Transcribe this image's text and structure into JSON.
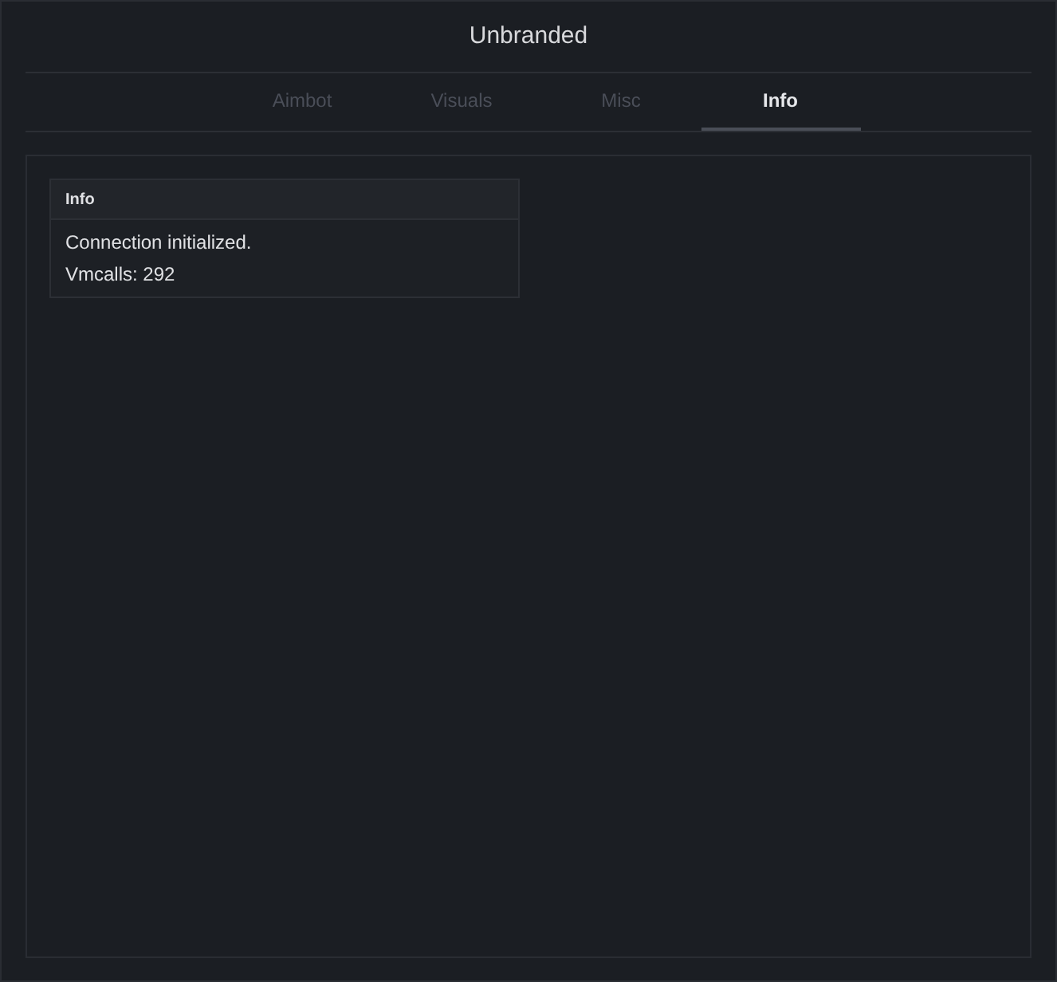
{
  "window": {
    "title": "Unbranded"
  },
  "tabs": [
    {
      "label": "Aimbot",
      "selected": false
    },
    {
      "label": "Visuals",
      "selected": false
    },
    {
      "label": "Misc",
      "selected": false
    },
    {
      "label": "Info",
      "selected": true
    }
  ],
  "panel": {
    "title": "Info",
    "lines": [
      "Connection initialized.",
      "Vmcalls: 292"
    ]
  }
}
